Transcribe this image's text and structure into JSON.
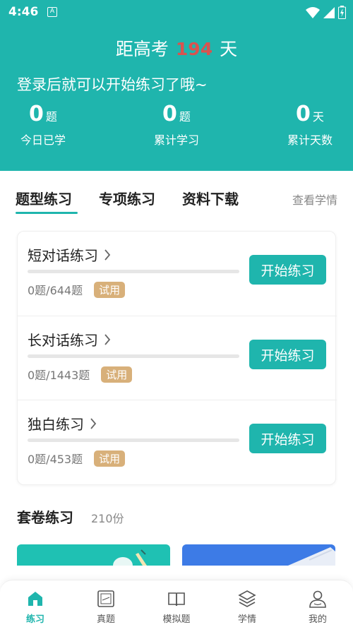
{
  "status_bar": {
    "time": "4:46",
    "notification_letter": "A"
  },
  "header": {
    "countdown_prefix": "距高考",
    "countdown_days": "194",
    "countdown_suffix": "天",
    "login_tip": "登录后就可以开始练习了哦~",
    "stats": [
      {
        "value": "0",
        "unit": "题",
        "label": "今日已学"
      },
      {
        "value": "0",
        "unit": "题",
        "label": "累计学习"
      },
      {
        "value": "0",
        "unit": "天",
        "label": "累计天数"
      }
    ]
  },
  "tabs": {
    "items": [
      "题型练习",
      "专项练习",
      "资料下载"
    ],
    "active_index": 0,
    "link": "查看学情"
  },
  "practice_items": [
    {
      "title": "短对话练习",
      "count": "0题/644题",
      "badge": "试用",
      "button": "开始练习",
      "progress": 0
    },
    {
      "title": "长对话练习",
      "count": "0题/1443题",
      "badge": "试用",
      "button": "开始练习",
      "progress": 0
    },
    {
      "title": "独白练习",
      "count": "0题/453题",
      "badge": "试用",
      "button": "开始练习",
      "progress": 0
    }
  ],
  "sets": {
    "title": "套卷练习",
    "count": "210份"
  },
  "bottom_nav": {
    "items": [
      {
        "label": "练习",
        "icon": "home-icon",
        "active": true
      },
      {
        "label": "真题",
        "icon": "exam-paper-icon",
        "active": false
      },
      {
        "label": "模拟题",
        "icon": "book-icon",
        "active": false
      },
      {
        "label": "学情",
        "icon": "layers-icon",
        "active": false
      },
      {
        "label": "我的",
        "icon": "user-icon",
        "active": false
      }
    ]
  },
  "colors": {
    "primary": "#1fb5ad",
    "countdown_accent": "#d9534f",
    "badge": "#d8b07a",
    "set_card_blue": "#3d7be6"
  }
}
